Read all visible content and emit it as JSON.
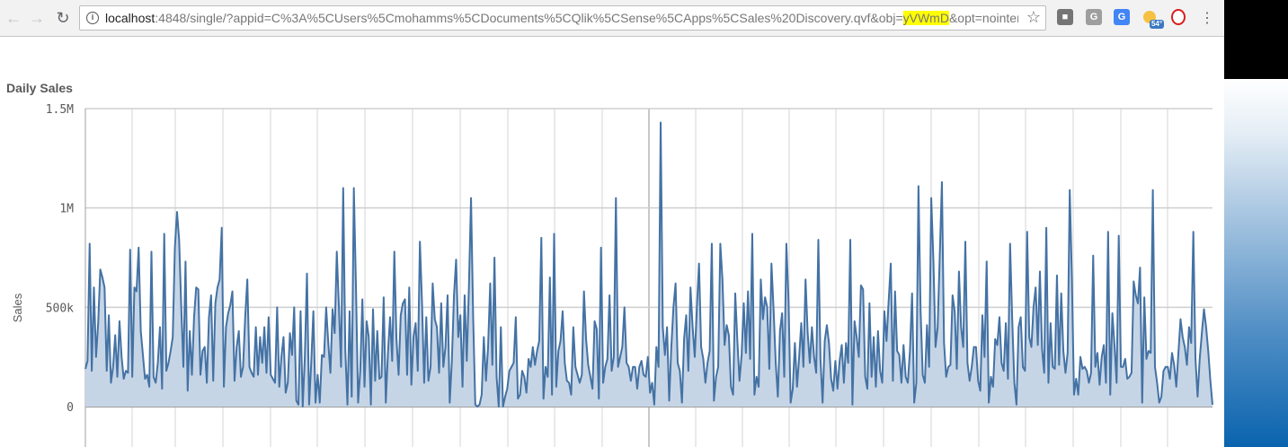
{
  "browser": {
    "url_host": "localhost",
    "url_rest_before": ":4848/single/?appid=C%3A%5CUsers%5Cmohamms%5CDocuments%5CQlik%5CSense%5CApps%5CSales%20Discovery.qvf&obj=",
    "url_highlight": "yVWmD",
    "url_rest_after": "&opt=nointeractic",
    "extensions": [
      {
        "name": "G",
        "color": "#9e9e9e"
      },
      {
        "name": "54°",
        "color": "#3b78c2"
      }
    ]
  },
  "colors": {
    "line": "#4472a4",
    "area": "#c6d5e6",
    "grid": "#e3e3e3",
    "axis": "#a0a0a0"
  },
  "chart_data": {
    "type": "area",
    "title": "Daily Sales",
    "xlabel": "",
    "ylabel": "Sales",
    "ylim": [
      0,
      1500000
    ],
    "yticks": [
      {
        "value": 0,
        "label": "0"
      },
      {
        "value": 500000,
        "label": "500k"
      },
      {
        "value": 1000000,
        "label": "1M"
      },
      {
        "value": 1500000,
        "label": "1.5M"
      }
    ],
    "grid": true,
    "legend": "none",
    "values": [
      190000,
      230000,
      820000,
      180000,
      600000,
      250000,
      420000,
      690000,
      650000,
      600000,
      180000,
      460000,
      120000,
      200000,
      360000,
      150000,
      430000,
      250000,
      140000,
      180000,
      170000,
      790000,
      150000,
      600000,
      580000,
      800000,
      380000,
      260000,
      140000,
      160000,
      100000,
      780000,
      150000,
      120000,
      220000,
      400000,
      90000,
      870000,
      180000,
      220000,
      280000,
      350000,
      800000,
      980000,
      840000,
      500000,
      200000,
      730000,
      80000,
      380000,
      160000,
      450000,
      600000,
      590000,
      160000,
      280000,
      300000,
      120000,
      450000,
      560000,
      130000,
      520000,
      600000,
      640000,
      900000,
      100000,
      400000,
      470000,
      510000,
      580000,
      130000,
      300000,
      380000,
      150000,
      200000,
      450000,
      640000,
      200000,
      170000,
      150000,
      400000,
      160000,
      350000,
      220000,
      400000,
      170000,
      450000,
      160000,
      140000,
      120000,
      500000,
      100000,
      250000,
      350000,
      70000,
      120000,
      370000,
      260000,
      500000,
      30000,
      10000,
      480000,
      0,
      250000,
      670000,
      10000,
      220000,
      480000,
      20000,
      160000,
      20000,
      260000,
      250000,
      500000,
      320000,
      170000,
      490000,
      370000,
      780000,
      500000,
      200000,
      1100000,
      280000,
      10000,
      480000,
      50000,
      1100000,
      600000,
      20000,
      180000,
      540000,
      100000,
      430000,
      350000,
      10000,
      490000,
      130000,
      380000,
      140000,
      150000,
      550000,
      20000,
      270000,
      450000,
      230000,
      780000,
      340000,
      160000,
      460000,
      520000,
      540000,
      160000,
      600000,
      110000,
      350000,
      420000,
      180000,
      830000,
      520000,
      120000,
      450000,
      130000,
      200000,
      620000,
      440000,
      400000,
      170000,
      520000,
      200000,
      300000,
      560000,
      20000,
      230000,
      560000,
      740000,
      350000,
      460000,
      100000,
      560000,
      230000,
      600000,
      1050000,
      450000,
      10000,
      0,
      10000,
      60000,
      350000,
      130000,
      300000,
      620000,
      210000,
      750000,
      150000,
      0,
      400000,
      0,
      50000,
      90000,
      180000,
      200000,
      220000,
      450000,
      40000,
      60000,
      180000,
      150000,
      70000,
      240000,
      200000,
      300000,
      210000,
      280000,
      330000,
      850000,
      40000,
      200000,
      150000,
      650000,
      60000,
      870000,
      100000,
      280000,
      330000,
      480000,
      220000,
      130000,
      120000,
      60000,
      400000,
      200000,
      160000,
      120000,
      160000,
      580000,
      340000,
      210000,
      150000,
      90000,
      430000,
      390000,
      40000,
      800000,
      120000,
      200000,
      240000,
      560000,
      180000,
      250000,
      1050000,
      200000,
      250000,
      300000,
      500000,
      220000,
      200000,
      130000,
      200000,
      200000,
      90000,
      200000,
      230000,
      160000,
      150000,
      250000,
      70000,
      120000,
      10000,
      300000,
      200000,
      1430000,
      400000,
      260000,
      400000,
      30000,
      300000,
      500000,
      620000,
      220000,
      180000,
      20000,
      340000,
      460000,
      180000,
      600000,
      400000,
      250000,
      500000,
      720000,
      300000,
      240000,
      120000,
      220000,
      280000,
      820000,
      30000,
      150000,
      200000,
      820000,
      640000,
      310000,
      410000,
      360000,
      100000,
      60000,
      570000,
      330000,
      130000,
      260000,
      520000,
      270000,
      580000,
      240000,
      870000,
      60000,
      150000,
      100000,
      640000,
      440000,
      550000,
      500000,
      190000,
      720000,
      490000,
      220000,
      50000,
      380000,
      470000,
      150000,
      820000,
      540000,
      20000,
      90000,
      320000,
      100000,
      250000,
      420000,
      200000,
      640000,
      370000,
      220000,
      400000,
      250000,
      170000,
      840000,
      240000,
      20000,
      330000,
      410000,
      320000,
      140000,
      80000,
      230000,
      90000,
      230000,
      310000,
      120000,
      320000,
      220000,
      840000,
      10000,
      430000,
      350000,
      250000,
      610000,
      590000,
      150000,
      90000,
      520000,
      150000,
      350000,
      100000,
      380000,
      180000,
      120000,
      480000,
      330000,
      530000,
      720000,
      130000,
      580000,
      280000,
      260000,
      120000,
      310000,
      150000,
      120000,
      280000,
      570000,
      20000,
      120000,
      1110000,
      480000,
      160000,
      120000,
      410000,
      200000,
      1050000,
      740000,
      300000,
      400000,
      760000,
      1130000,
      320000,
      150000,
      200000,
      210000,
      560000,
      480000,
      190000,
      680000,
      400000,
      300000,
      830000,
      220000,
      130000,
      200000,
      300000,
      300000,
      130000,
      80000,
      460000,
      250000,
      730000,
      20000,
      150000,
      100000,
      340000,
      310000,
      450000,
      220000,
      180000,
      420000,
      140000,
      820000,
      440000,
      120000,
      10000,
      400000,
      450000,
      200000,
      180000,
      880000,
      350000,
      300000,
      500000,
      600000,
      310000,
      680000,
      290000,
      170000,
      900000,
      120000,
      420000,
      200000,
      190000,
      660000,
      210000,
      570000,
      280000,
      170000,
      270000,
      1090000,
      650000,
      60000,
      140000,
      60000,
      250000,
      190000,
      200000,
      180000,
      120000,
      170000,
      760000,
      200000,
      270000,
      110000,
      250000,
      310000,
      120000,
      880000,
      60000,
      470000,
      310000,
      120000,
      860000,
      200000,
      200000,
      240000,
      140000,
      150000,
      170000,
      630000,
      560000,
      520000,
      700000,
      20000,
      550000,
      240000,
      280000,
      270000,
      1090000,
      200000,
      120000,
      20000,
      50000,
      180000,
      200000,
      200000,
      140000,
      270000,
      210000,
      100000,
      270000,
      440000,
      350000,
      300000,
      210000,
      400000,
      320000,
      880000,
      240000,
      50000,
      240000,
      370000,
      490000,
      400000,
      280000,
      130000,
      10000
    ]
  }
}
